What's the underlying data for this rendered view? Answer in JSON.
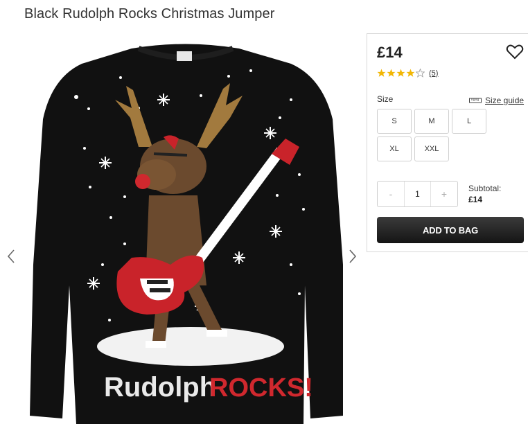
{
  "product": {
    "title": "Black Rudolph Rocks Christmas Jumper",
    "print_text_a": "Rudolph",
    "print_text_b": "ROCKS!"
  },
  "gallery": {
    "prev_icon": "chevron-left-icon",
    "next_icon": "chevron-right-icon"
  },
  "panel": {
    "price": "£14",
    "wishlist_icon": "heart-icon",
    "rating": {
      "stars_filled": 4,
      "stars_total": 5,
      "review_count": "(5)"
    },
    "size_label": "Size",
    "size_guide_label": "Size guide",
    "sizes": [
      "S",
      "M",
      "L",
      "XL",
      "XXL"
    ],
    "quantity": {
      "decrement": "-",
      "value": "1",
      "increment": "+"
    },
    "subtotal_label": "Subtotal:",
    "subtotal_value": "£14",
    "add_to_bag_label": "ADD TO BAG"
  },
  "colors": {
    "star": "#f2b705",
    "button": "#1e1e1e",
    "jumper": "#101010",
    "guitar": "#c9232a"
  }
}
